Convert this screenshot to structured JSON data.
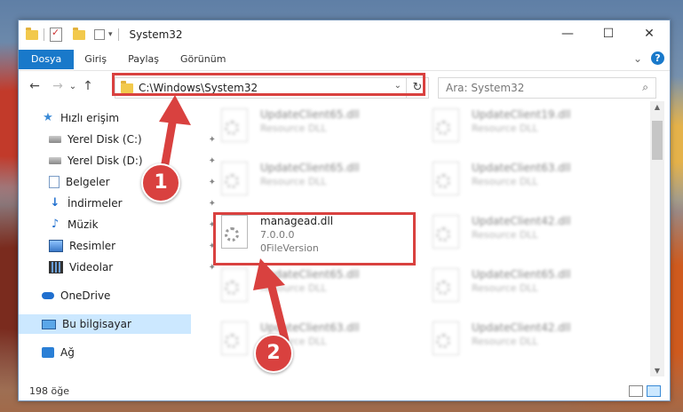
{
  "window": {
    "title": "System32",
    "controls": {
      "minimize": "—",
      "maximize": "☐",
      "close": "✕"
    }
  },
  "ribbon": {
    "tabs": [
      {
        "label": "Dosya",
        "active": true
      },
      {
        "label": "Giriş"
      },
      {
        "label": "Paylaş"
      },
      {
        "label": "Görünüm"
      }
    ],
    "expand_glyph": "⌄",
    "help": "?"
  },
  "nav": {
    "back": "←",
    "forward": "→",
    "recent": "⌄",
    "up": "↑"
  },
  "address": {
    "path": "C:\\Windows\\System32",
    "dropdown": "⌄",
    "refresh": "↻"
  },
  "search": {
    "placeholder": "Ara: System32",
    "icon": "search-icon"
  },
  "sidebar": {
    "items": [
      {
        "label": "Hızlı erişim",
        "icon": "star-icon"
      },
      {
        "label": "Yerel Disk (C:)",
        "icon": "drive-icon",
        "pinned": true
      },
      {
        "label": "Yerel Disk (D:)",
        "icon": "drive-icon",
        "pinned": true
      },
      {
        "label": "Belgeler",
        "icon": "documents-icon",
        "pinned": true
      },
      {
        "label": "İndirmeler",
        "icon": "download-icon",
        "pinned": true
      },
      {
        "label": "Müzik",
        "icon": "music-icon",
        "pinned": true
      },
      {
        "label": "Resimler",
        "icon": "pictures-icon",
        "pinned": true
      },
      {
        "label": "Videolar",
        "icon": "videos-icon",
        "pinned": true
      },
      {
        "label": "OneDrive",
        "icon": "cloud-icon"
      },
      {
        "label": "Bu bilgisayar",
        "icon": "computer-icon",
        "selected": true
      },
      {
        "label": "Ağ",
        "icon": "network-icon"
      }
    ],
    "pin_glyph": "📌"
  },
  "files": {
    "left_column": [
      {
        "name": "UpdateClient65.dll",
        "line1": "Resource DLL",
        "line2": ""
      },
      {
        "name": "UpdateClient65.dll",
        "line1": "Resource DLL",
        "line2": ""
      },
      {
        "name": "managead.dll",
        "line1": "7.0.0.0",
        "line2": "0FileVersion",
        "highlighted": true
      },
      {
        "name": "UpdateClient65.dll",
        "line1": "Resource DLL",
        "line2": ""
      },
      {
        "name": "UpdateClient63.dll",
        "line1": "Resource DLL",
        "line2": ""
      }
    ],
    "right_column": [
      {
        "name": "UpdateClient19.dll",
        "line1": "Resource DLL"
      },
      {
        "name": "UpdateClient63.dll",
        "line1": "Resource DLL"
      },
      {
        "name": "UpdateClient42.dll",
        "line1": "Resource DLL"
      },
      {
        "name": "UpdateClient65.dll",
        "line1": "Resource DLL"
      },
      {
        "name": "UpdateClient42.dll",
        "line1": "Resource DLL"
      }
    ]
  },
  "status": {
    "item_count": "198 öğe"
  },
  "annotations": {
    "step1": "1",
    "step2": "2",
    "color": "#d9413f"
  }
}
